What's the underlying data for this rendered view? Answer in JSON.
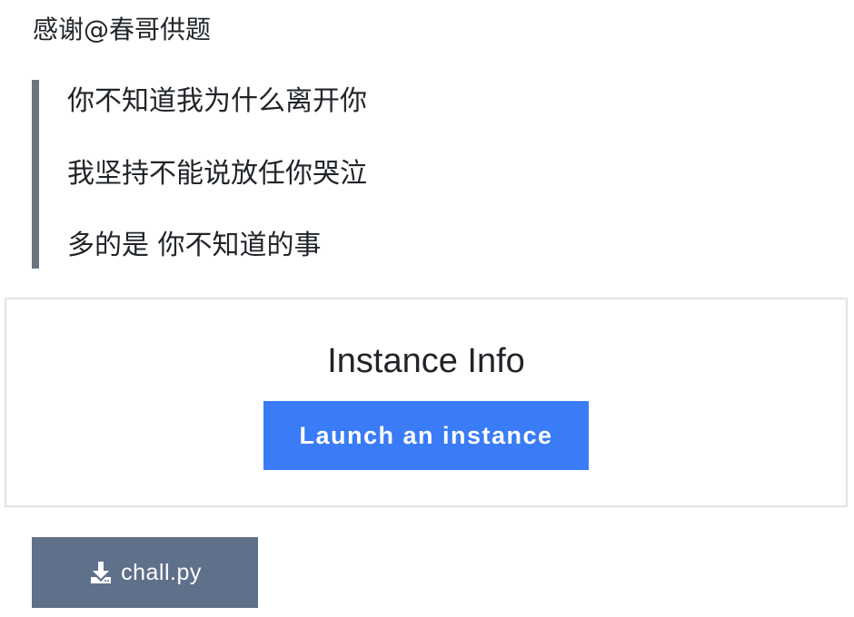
{
  "credit": "感谢@春哥供题",
  "quote": {
    "lines": [
      "你不知道我为什么离开你",
      "我坚持不能说放任你哭泣",
      "多的是 你不知道的事"
    ]
  },
  "instance": {
    "title": "Instance Info",
    "launch_label": "Launch an instance"
  },
  "attachment": {
    "icon": "download-icon",
    "filename": "chall.py"
  },
  "colors": {
    "quote_border": "#6c757d",
    "launch_button": "#3a7bf7",
    "download_button": "#5f708b",
    "card_border": "#e3e3e3"
  }
}
